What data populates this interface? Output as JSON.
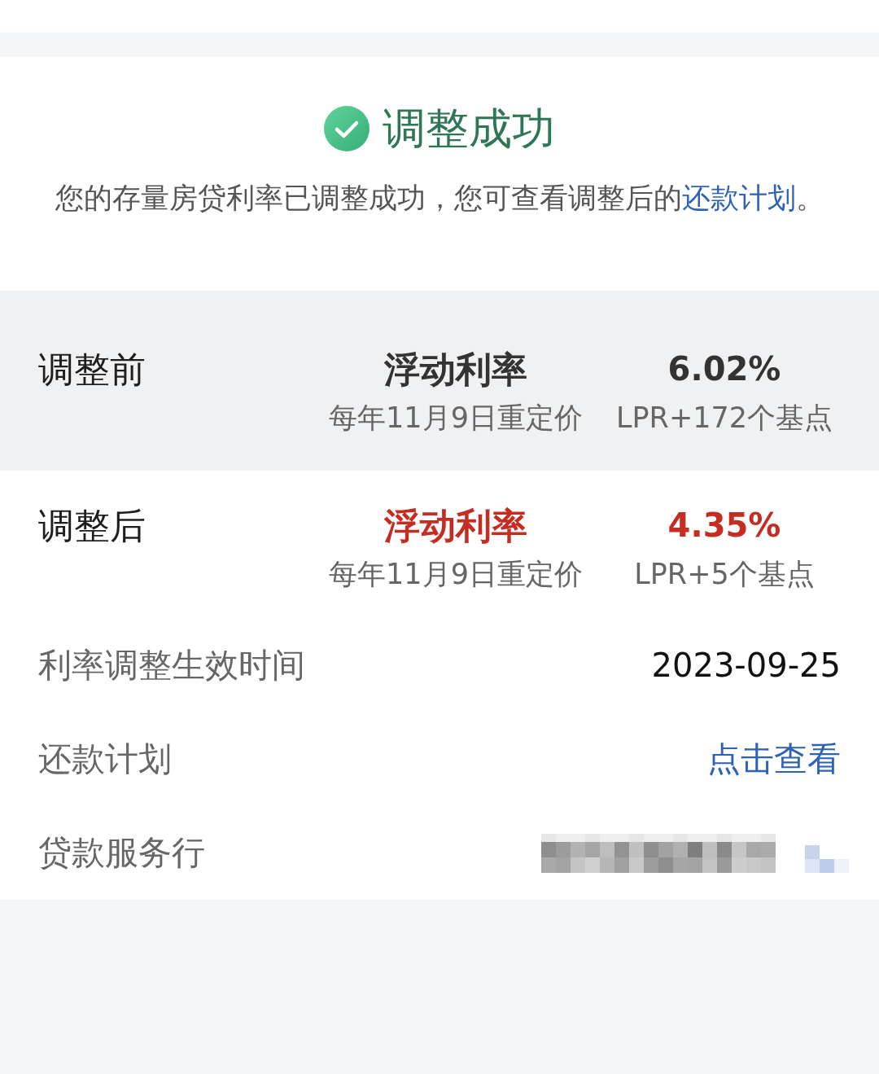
{
  "success": {
    "title": "调整成功",
    "message": "您的存量房贷利率已调整成功，您可查看调整后的",
    "message_link": "还款计划",
    "message_end": "。"
  },
  "rate_rows": [
    {
      "label": "调整前",
      "rate_type": "浮动利率",
      "reprice": "每年11月9日重定价",
      "rate": "6.02%",
      "spread": "LPR+172个基点",
      "highlighted": false
    },
    {
      "label": "调整后",
      "rate_type": "浮动利率",
      "reprice": "每年11月9日重定价",
      "rate": "4.35%",
      "spread": "LPR+5个基点",
      "highlighted": true
    }
  ],
  "details": [
    {
      "kind": "text",
      "label": "利率调整生效时间",
      "value": "2023-09-25"
    },
    {
      "kind": "link",
      "label": "还款计划",
      "value": "点击查看"
    },
    {
      "kind": "redacted",
      "label": "贷款服务行"
    }
  ]
}
